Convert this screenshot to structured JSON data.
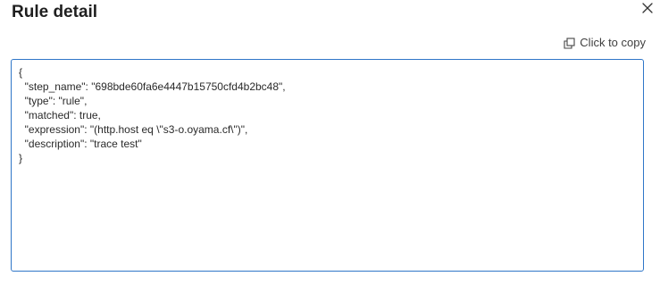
{
  "dialog": {
    "title": "Rule detail",
    "close_icon": "close-icon",
    "copy_icon": "copy-icon",
    "copy_label": "Click to copy"
  },
  "code": {
    "lines": [
      "{",
      "  \"step_name\": \"698bde60fa6e4447b15750cfd4b2bc48\",",
      "  \"type\": \"rule\",",
      "  \"matched\": true,",
      "  \"expression\": \"(http.host eq \\\"s3-o.oyama.cf\\\")\",",
      "  \"description\": \"trace test\"",
      "}"
    ]
  },
  "colors": {
    "border_accent": "#2f76c8",
    "text": "#2a2a2a"
  }
}
